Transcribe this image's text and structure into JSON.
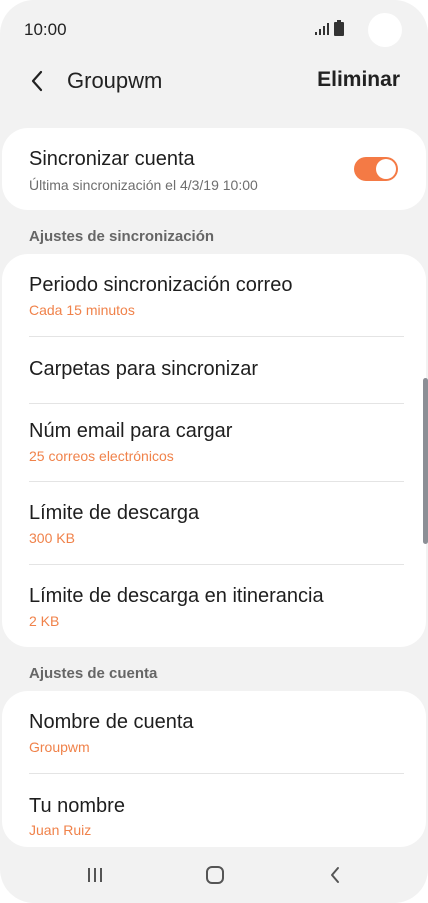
{
  "status_bar": {
    "time": "10:00"
  },
  "app_bar": {
    "title": "Groupwm",
    "delete_label": "Eliminar"
  },
  "sync_account": {
    "title": "Sincronizar cuenta",
    "last_sync": "Última sincronización el 4/3/19  10:00",
    "enabled": true
  },
  "sync_settings": {
    "header": "Ajustes de sincronización",
    "items": [
      {
        "title": "Periodo sincronización correo",
        "value": "Cada 15 minutos"
      },
      {
        "title": "Carpetas para sincronizar",
        "value": ""
      },
      {
        "title": "Núm email para cargar",
        "value": "25 correos electrónicos"
      },
      {
        "title": "Límite de descarga",
        "value": "300 KB"
      },
      {
        "title": "Límite de descarga en itinerancia",
        "value": "2 KB"
      }
    ]
  },
  "account_settings": {
    "header": "Ajustes de cuenta",
    "items": [
      {
        "title": "Nombre de cuenta",
        "value": "Groupwm"
      },
      {
        "title": "Tu nombre",
        "value": "Juan Ruiz"
      }
    ]
  },
  "colors": {
    "accent": "#f47a45",
    "background": "#f2f2f2",
    "card": "#ffffff"
  },
  "icons": {
    "back": "chevron-left-icon",
    "recents": "recent-apps-icon",
    "home": "home-icon",
    "nav_back": "back-icon"
  }
}
